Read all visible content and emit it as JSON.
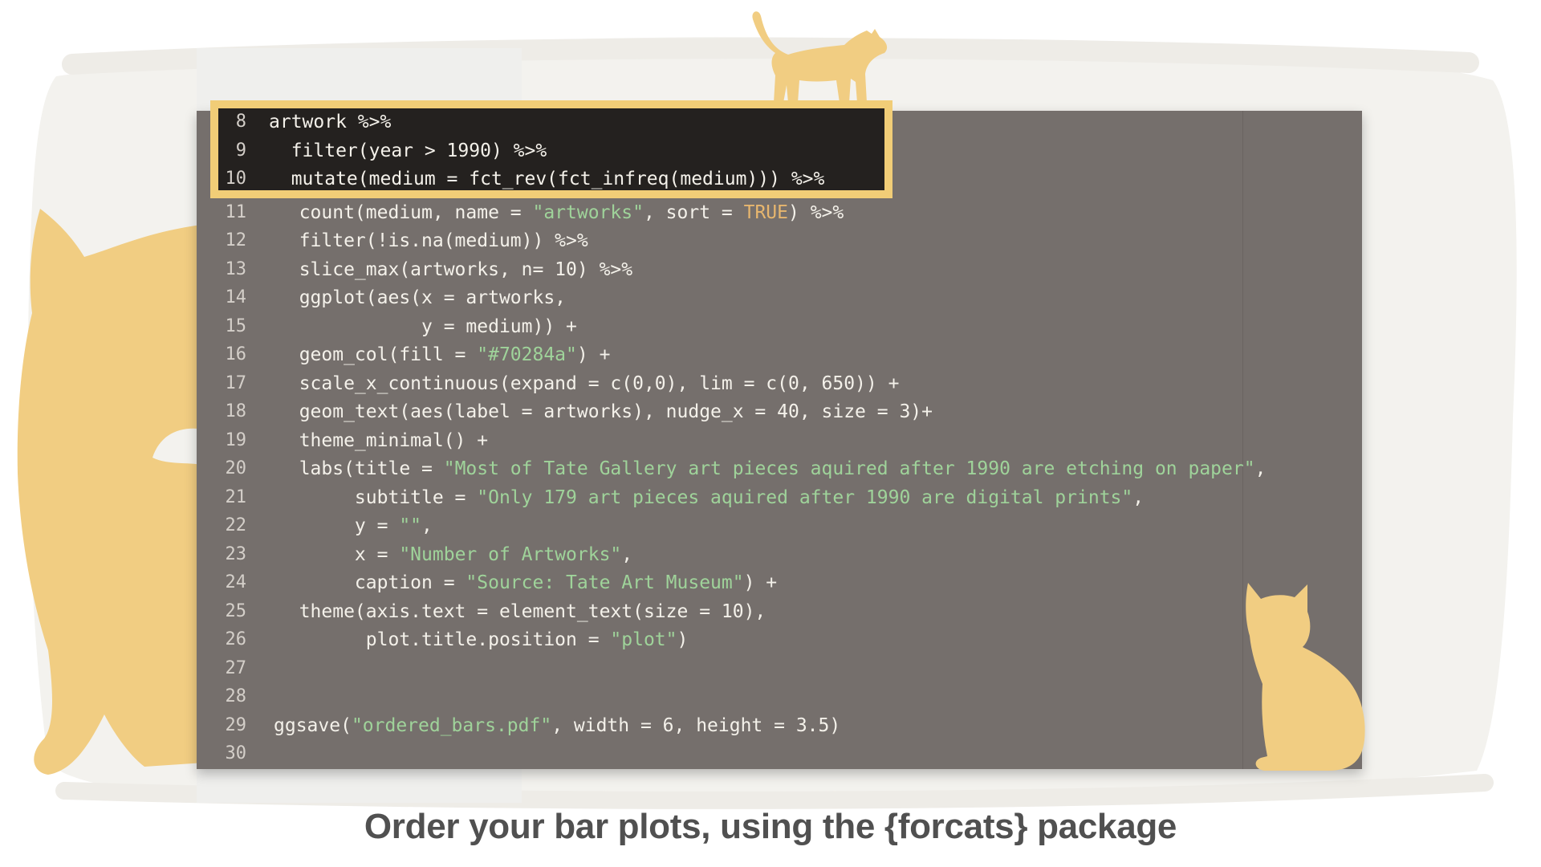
{
  "colors": {
    "panel": "#756f6c",
    "highlight_border": "#f1cd77",
    "highlight_bg": "#24211f",
    "cat": "#f1cd82",
    "string": "#9fd39a",
    "keyword": "#e7b66e"
  },
  "code_lines": [
    {
      "n": "8",
      "text": "artwork %>%"
    },
    {
      "n": "9",
      "text": "  filter(year > 1990) %>%"
    },
    {
      "n": "10",
      "text": "  mutate(medium = fct_rev(fct_infreq(medium))) %>%"
    },
    {
      "n": "11",
      "text": "  count(medium, name = \"artworks\", sort = TRUE) %>%"
    },
    {
      "n": "12",
      "text": "  filter(!is.na(medium)) %>%"
    },
    {
      "n": "13",
      "text": "  slice_max(artworks, n= 10) %>%"
    },
    {
      "n": "14",
      "text": "  ggplot(aes(x = artworks,"
    },
    {
      "n": "15",
      "text": "             y = medium)) +"
    },
    {
      "n": "16",
      "text": "  geom_col(fill = \"#70284a\") +"
    },
    {
      "n": "17",
      "text": "  scale_x_continuous(expand = c(0,0), lim = c(0, 650)) +"
    },
    {
      "n": "18",
      "text": "  geom_text(aes(label = artworks), nudge_x = 40, size = 3)+"
    },
    {
      "n": "19",
      "text": "  theme_minimal() +"
    },
    {
      "n": "20",
      "text": "  labs(title = \"Most of Tate Gallery art pieces aquired after 1990 are etching on paper\","
    },
    {
      "n": "21",
      "text": "       subtitle = \"Only 179 art pieces aquired after 1990 are digital prints\","
    },
    {
      "n": "22",
      "text": "       y = \"\","
    },
    {
      "n": "23",
      "text": "       x = \"Number of Artworks\","
    },
    {
      "n": "24",
      "text": "       caption = \"Source: Tate Art Museum\") +"
    },
    {
      "n": "25",
      "text": "  theme(axis.text = element_text(size = 10),"
    },
    {
      "n": "26",
      "text": "        plot.title.position = \"plot\")"
    },
    {
      "n": "27",
      "text": ""
    },
    {
      "n": "28",
      "text": ""
    },
    {
      "n": "29",
      "text": "ggsave(\"ordered_bars.pdf\", width = 6, height = 3.5)"
    },
    {
      "n": "30",
      "text": ""
    }
  ],
  "caption": "Order your bar plots, using the {forcats} package",
  "icons": [
    "walking-cat-icon",
    "sitting-cat-icon",
    "large-cat-silhouette-icon"
  ]
}
